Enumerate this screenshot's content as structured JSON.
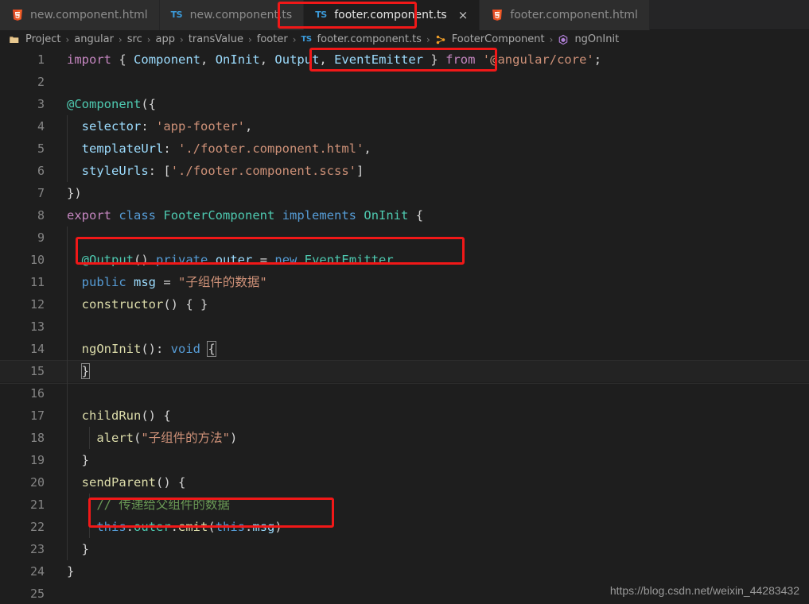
{
  "tabs": [
    {
      "label": "new.component.html",
      "icon": "html5-icon",
      "active": false,
      "closable": false
    },
    {
      "label": "new.component.ts",
      "icon": "typescript-icon",
      "active": false,
      "closable": false
    },
    {
      "label": "footer.component.ts",
      "icon": "typescript-icon",
      "active": true,
      "closable": true,
      "close_label": "×"
    },
    {
      "label": "footer.component.html",
      "icon": "html5-icon",
      "active": false,
      "closable": false
    }
  ],
  "breadcrumb": {
    "separator": "›",
    "items": [
      {
        "label": "Project",
        "icon": "folder-icon"
      },
      {
        "label": "angular",
        "icon": ""
      },
      {
        "label": "src",
        "icon": ""
      },
      {
        "label": "app",
        "icon": ""
      },
      {
        "label": "transValue",
        "icon": ""
      },
      {
        "label": "footer",
        "icon": ""
      },
      {
        "label": "footer.component.ts",
        "icon": "typescript-icon"
      },
      {
        "label": "FooterComponent",
        "icon": "class-icon"
      },
      {
        "label": "ngOnInit",
        "icon": "method-icon"
      }
    ]
  },
  "editor": {
    "language": "typescript",
    "current_line": 15,
    "line_numbers": [
      1,
      2,
      3,
      4,
      5,
      6,
      7,
      8,
      9,
      10,
      11,
      12,
      13,
      14,
      15,
      16,
      17,
      18,
      19,
      20,
      21,
      22,
      23,
      24,
      25
    ],
    "lines": [
      "import { Component, OnInit, Output, EventEmitter } from '@angular/core';",
      "",
      "@Component({",
      "  selector: 'app-footer',",
      "  templateUrl: './footer.component.html',",
      "  styleUrls: ['./footer.component.scss']",
      "})",
      "export class FooterComponent implements OnInit {",
      "",
      "  @Output() private outer = new EventEmitter",
      "  public msg = \"子组件的数据\"",
      "  constructor() { }",
      "",
      "  ngOnInit(): void {",
      "  }",
      "",
      "  childRun() {",
      "    alert(\"子组件的方法\")",
      "  }",
      "  sendParent() {",
      "    // 传递给父组件的数据",
      "    this.outer.emit(this.msg)",
      "  }",
      "}",
      ""
    ]
  },
  "annotations": [
    {
      "name": "active-tab-highlight",
      "target": "tab-footer-component-ts"
    },
    {
      "name": "import-output-eventemitter-highlight",
      "target": "line-1-output-eventemitter"
    },
    {
      "name": "output-declaration-highlight",
      "target": "line-10"
    },
    {
      "name": "emit-call-highlight",
      "target": "line-22"
    }
  ],
  "watermark": {
    "text": "https://blog.csdn.net/weixin_44283432"
  },
  "colors": {
    "editor_background": "#1e1e1e",
    "tabbar_background": "#252526",
    "inactive_tab": "#2d2d2d",
    "annotation_red": "#f11818",
    "keyword_purple": "#c586c0",
    "keyword_blue": "#569cd6",
    "type_teal": "#4ec9b0",
    "function_yellow": "#dcdcaa",
    "variable_lightblue": "#9cdcfe",
    "string_orange": "#ce9178",
    "comment_green": "#6a9955",
    "line_number_gray": "#858585"
  }
}
